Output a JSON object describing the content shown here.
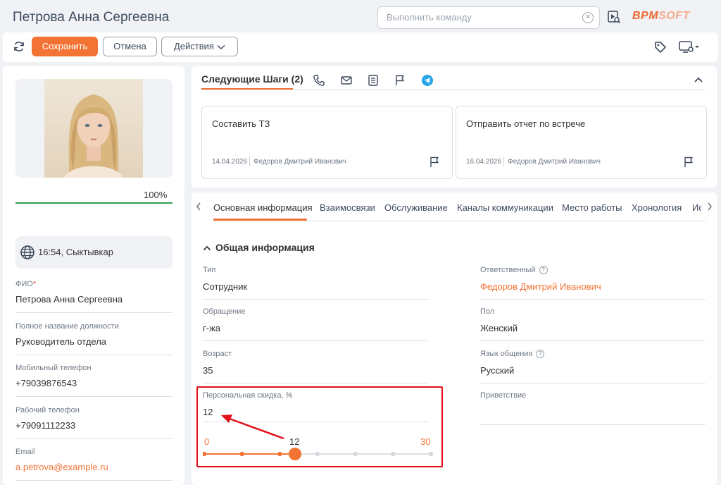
{
  "header": {
    "title": "Петрова Анна Сергеевна",
    "command_placeholder": "Выполнить команду",
    "logo_part1": "BPM",
    "logo_part2": "SOFT"
  },
  "toolbar": {
    "save_label": "Сохранить",
    "cancel_label": "Отмена",
    "actions_label": "Действия"
  },
  "profile": {
    "completeness_percent": 100,
    "completeness_label": "100%",
    "timezone_text": "16:54, Сыктывкар",
    "fields": [
      {
        "label": "ФИО",
        "required": "*",
        "value": "Петрова Анна Сергеевна"
      },
      {
        "label": "Полное название должности",
        "value": "Руководитель отдела"
      },
      {
        "label": "Мобильный телефон",
        "value": "+79039876543"
      },
      {
        "label": "Рабочий телефон",
        "value": "+79091112233"
      },
      {
        "label": "Email",
        "value": "a.petrova@example.ru"
      }
    ]
  },
  "next_steps": {
    "title": "Следующие Шаги (2)",
    "tasks": [
      {
        "title": "Составить ТЗ",
        "date": "14.04.2026",
        "owner": "Федоров Дмитрий Иванович"
      },
      {
        "title": "Отправить отчет по встрече",
        "date": "16.04.2026",
        "owner": "Федоров Дмитрий Иванович"
      }
    ]
  },
  "tabs": [
    {
      "label": "Основная информация",
      "active": true
    },
    {
      "label": "Взаимосвязи"
    },
    {
      "label": "Обслуживание"
    },
    {
      "label": "Каналы коммуникации"
    },
    {
      "label": "Место работы"
    },
    {
      "label": "Хронология"
    },
    {
      "label": "Ис"
    }
  ],
  "general": {
    "section_title": "Общая информация",
    "left_fields": [
      {
        "label": "Тип",
        "value": "Сотрудник"
      },
      {
        "label": "Обращение",
        "value": "г-жа"
      },
      {
        "label": "Возраст",
        "value": "35"
      }
    ],
    "right_fields": [
      {
        "label": "Ответственный",
        "value": "Федоров Дмитрий Иванович",
        "help": "?"
      },
      {
        "label": "Пол",
        "value": "Женский"
      },
      {
        "label": "Язык общения",
        "value": "Русский",
        "help": "?"
      },
      {
        "label": "Приветствие",
        "value": ""
      }
    ],
    "discount": {
      "label": "Персональная скидка, %",
      "value": "12",
      "min": 0,
      "max": 30,
      "min_label": "0",
      "max_label": "30",
      "current_label": "12",
      "current": 12
    }
  },
  "colors": {
    "accent": "#f37335",
    "link": "#f37335",
    "progress": "#2ea04f",
    "highlight": "#e3101b"
  }
}
